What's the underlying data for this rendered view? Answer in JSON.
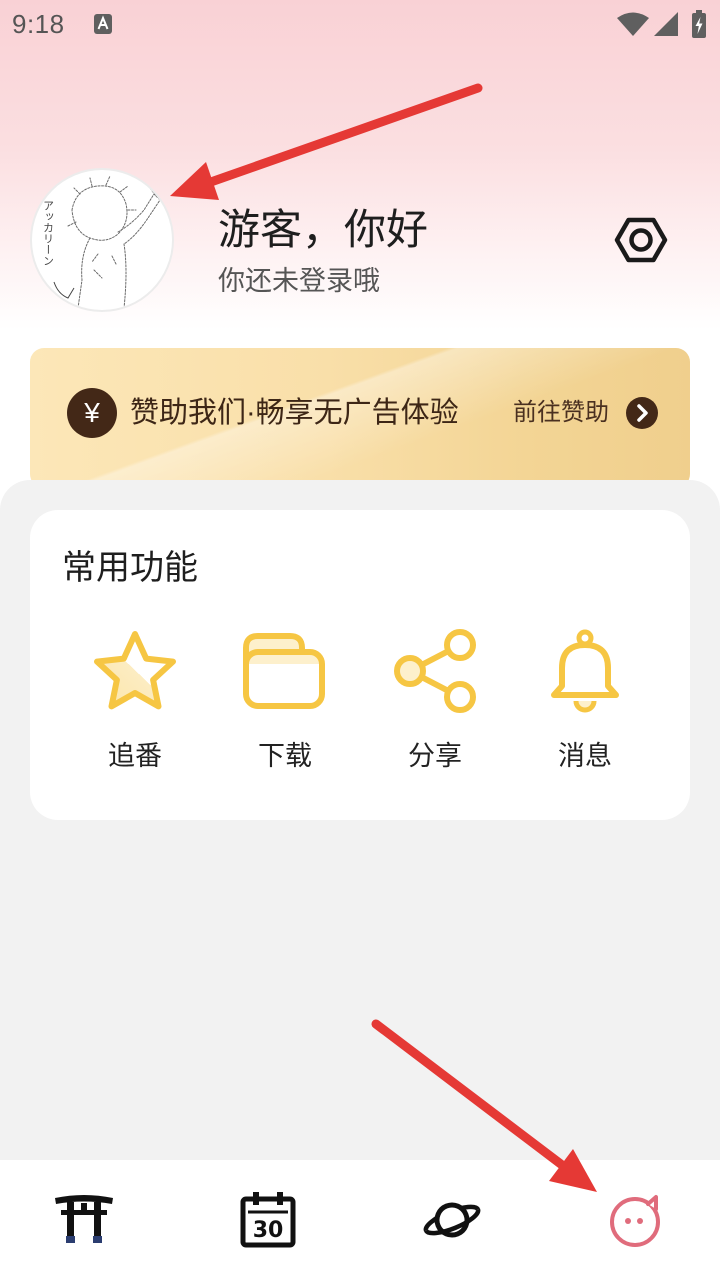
{
  "status_bar": {
    "time": "9:18",
    "icons": [
      "text-notification-icon",
      "wifi-icon",
      "signal-icon",
      "battery-charging-icon"
    ]
  },
  "profile": {
    "avatar_caption": "アッカリーン",
    "greeting": "游客，你好",
    "subtitle": "你还未登录哦",
    "settings_icon": "settings-hexagon-icon"
  },
  "sponsor": {
    "currency_symbol": "¥",
    "text": "赞助我们·畅享无广告体验",
    "action_label": "前往赞助",
    "action_icon": "chevron-right-icon"
  },
  "common_features": {
    "title": "常用功能",
    "items": [
      {
        "label": "追番",
        "icon": "star-icon"
      },
      {
        "label": "下载",
        "icon": "folder-icon"
      },
      {
        "label": "分享",
        "icon": "share-icon"
      },
      {
        "label": "消息",
        "icon": "bell-icon"
      }
    ]
  },
  "bottom_nav": {
    "items": [
      {
        "icon": "torii-gate-icon",
        "active": false
      },
      {
        "icon": "calendar-icon",
        "day": "30",
        "active": false
      },
      {
        "icon": "planet-icon",
        "active": false
      },
      {
        "icon": "cat-face-icon",
        "active": true
      }
    ]
  },
  "annotations": {
    "arrow_color": "#e53935",
    "arrow_count": 2
  },
  "colors": {
    "accent_gold": "#f6c643",
    "gold_light": "#fdf0cc",
    "sponsor_brown": "#432817",
    "active_pink": "#e06c7c",
    "panel_bg": "#f2f2f2"
  }
}
